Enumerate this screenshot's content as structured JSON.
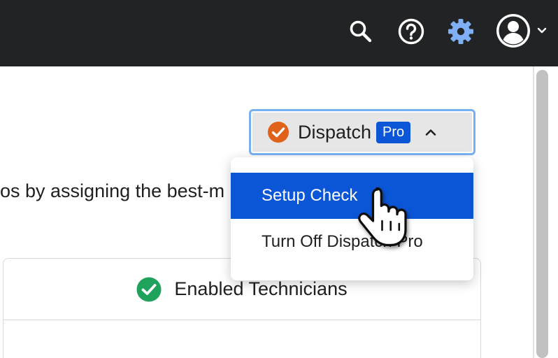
{
  "topbar": {
    "icons": [
      "search-icon",
      "help-icon",
      "gear-icon",
      "user-avatar-icon",
      "chevron-down-icon"
    ],
    "gear_color": "#7fb0f5"
  },
  "dispatch": {
    "label": "Dispatch",
    "badge": "Pro",
    "status_color": "#e0611a",
    "badge_color": "#0b56d6"
  },
  "description": "os by assigning the best-m",
  "menu": {
    "items": [
      "Setup Check",
      "Turn Off Dispatch Pro"
    ],
    "selected_index": 0
  },
  "panel": {
    "title": "Enabled Technicians",
    "check_color": "#1fa35c"
  }
}
